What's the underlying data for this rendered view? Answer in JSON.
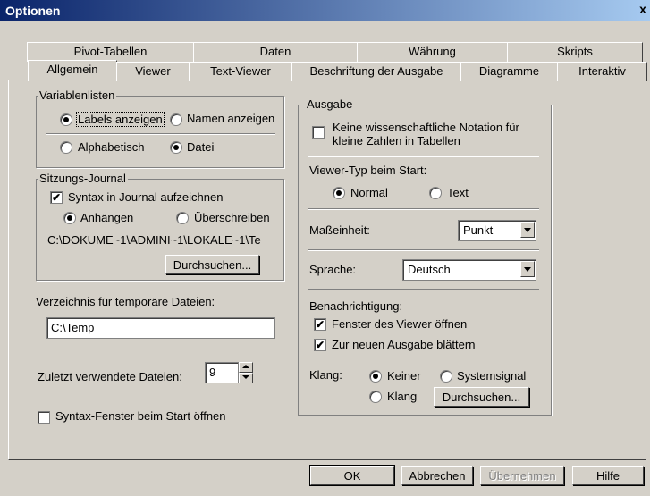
{
  "window": {
    "title": "Optionen",
    "close": "x"
  },
  "tabs_row1": [
    "Pivot-Tabellen",
    "Daten",
    "Währung",
    "Skripts"
  ],
  "tabs_row2": [
    "Allgemein",
    "Viewer",
    "Text-Viewer",
    "Beschriftung der Ausgabe",
    "Diagramme",
    "Interaktiv"
  ],
  "variablenlisten": {
    "title": "Variablenlisten",
    "labels": "Labels anzeigen",
    "namen": "Namen anzeigen",
    "alpha": "Alphabetisch",
    "datei": "Datei",
    "labels_selected": true,
    "datei_selected": true
  },
  "journal": {
    "title": "Sitzungs-Journal",
    "syntax": "Syntax in Journal aufzeichnen",
    "syntax_checked": true,
    "anhaengen": "Anhängen",
    "ueberschreiben": "Überschreiben",
    "path": "C:\\DOKUME~1\\ADMINI~1\\LOKALE~1\\Te",
    "browse": "Durchsuchen..."
  },
  "temp": {
    "label": "Verzeichnis für temporäre Dateien:",
    "value": "C:\\Temp"
  },
  "recent": {
    "label": "Zuletzt verwendete Dateien:",
    "value": "9"
  },
  "syntax_window": {
    "label": "Syntax-Fenster beim Start öffnen",
    "checked": false
  },
  "ausgabe": {
    "title": "Ausgabe",
    "notation": "Keine wissenschaftliche Notation für",
    "notation2": "kleine Zahlen in Tabellen",
    "viewer_type": "Viewer-Typ beim Start:",
    "normal": "Normal",
    "text": "Text",
    "unit_label": "Maßeinheit:",
    "unit_value": "Punkt",
    "lang_label": "Sprache:",
    "lang_value": "Deutsch",
    "notify": "Benachrichtigung:",
    "open_viewer": "Fenster des Viewer öffnen",
    "scroll": "Zur neuen Ausgabe blättern",
    "sound": "Klang:",
    "keiner": "Keiner",
    "system": "Systemsignal",
    "klang": "Klang",
    "browse": "Durchsuchen..."
  },
  "buttons": {
    "ok": "OK",
    "cancel": "Abbrechen",
    "apply": "Übernehmen",
    "help": "Hilfe"
  }
}
